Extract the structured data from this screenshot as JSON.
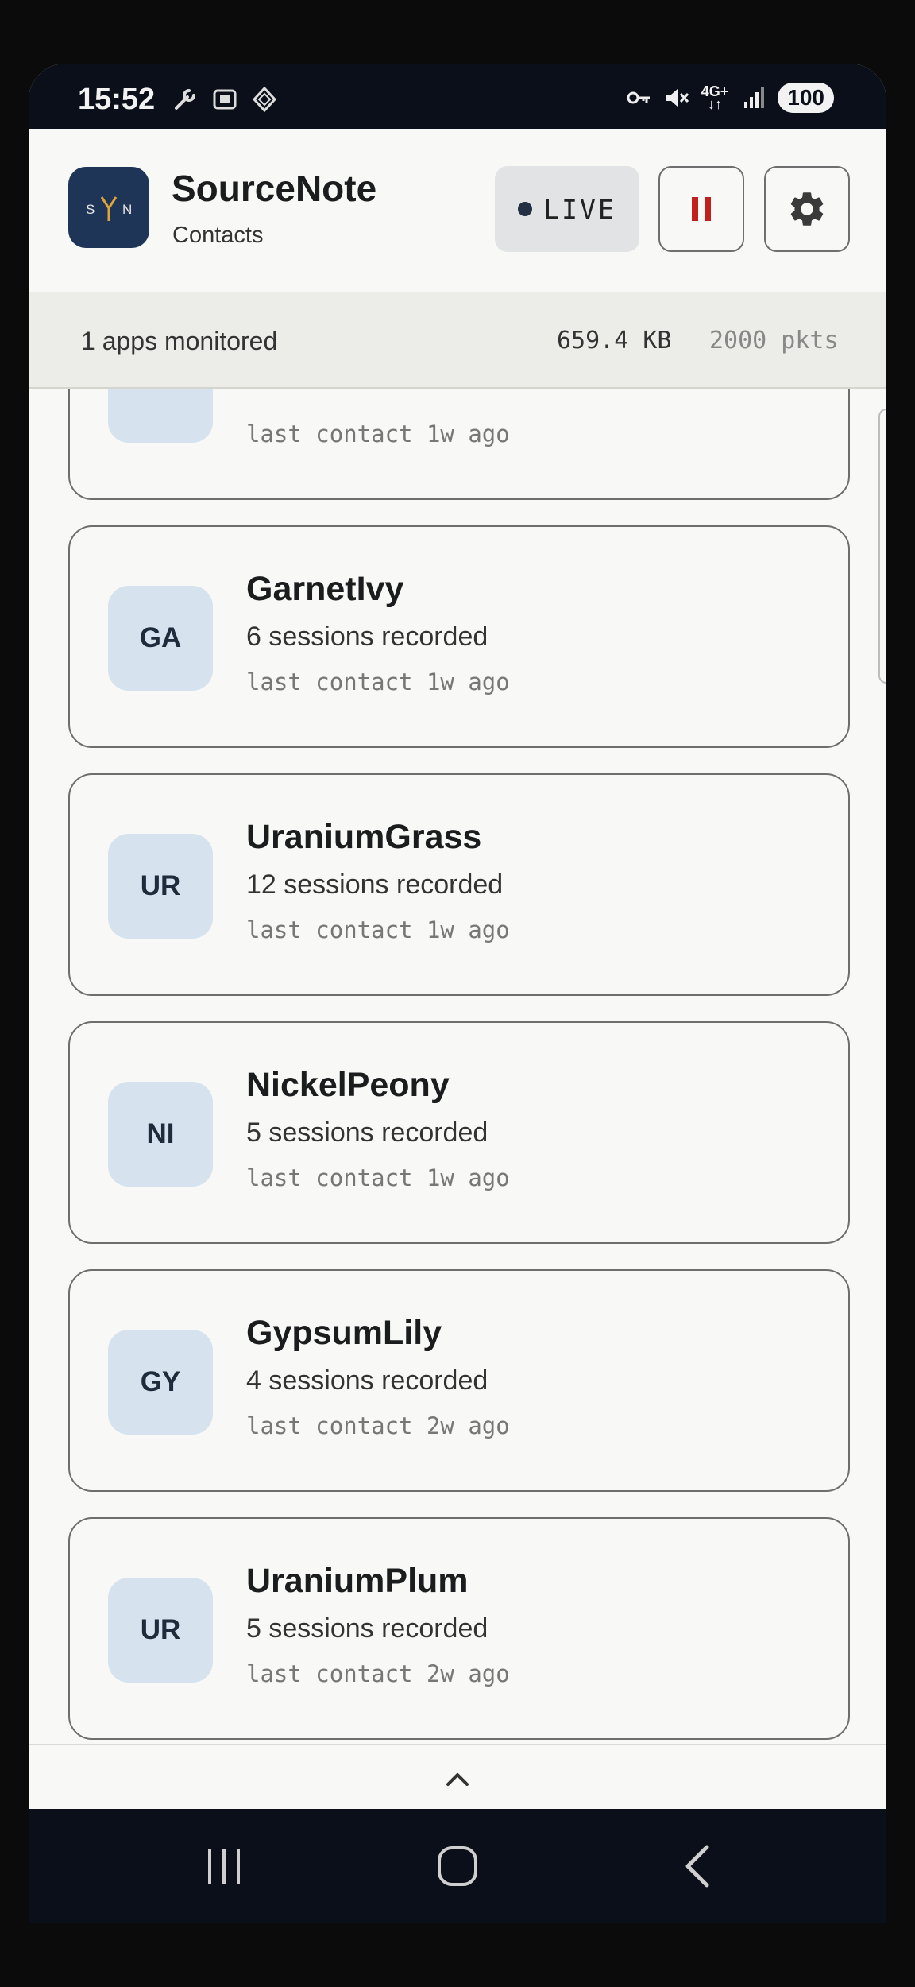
{
  "status_bar": {
    "time": "15:52",
    "battery": "100",
    "network": "4G+",
    "left_icons": [
      "wrench-icon",
      "screenshot-icon",
      "shield-icon"
    ],
    "right_icons": [
      "vpn-key-icon",
      "mute-icon",
      "network-icon",
      "signal-icon",
      "battery-icon"
    ]
  },
  "header": {
    "logo_text": "SYN",
    "title": "SourceNote",
    "subtitle": "Contacts",
    "live_label": "LIVE",
    "pause_icon": "pause-icon",
    "settings_icon": "gear-icon",
    "accent_color": "#1e3557",
    "pause_color": "#c0211f"
  },
  "info_bar": {
    "apps_monitored": "1 apps monitored",
    "data_size": "659.4 KB",
    "packets": "2000 pkts"
  },
  "contacts": [
    {
      "initials": "",
      "name": "",
      "sessions": "",
      "last_contact": "last contact 1w ago"
    },
    {
      "initials": "GA",
      "name": "GarnetIvy",
      "sessions": "6 sessions recorded",
      "last_contact": "last contact 1w ago"
    },
    {
      "initials": "UR",
      "name": "UraniumGrass",
      "sessions": "12 sessions recorded",
      "last_contact": "last contact 1w ago"
    },
    {
      "initials": "NI",
      "name": "NickelPeony",
      "sessions": "5 sessions recorded",
      "last_contact": "last contact 1w ago"
    },
    {
      "initials": "GY",
      "name": "GypsumLily",
      "sessions": "4 sessions recorded",
      "last_contact": "last contact 2w ago"
    },
    {
      "initials": "UR",
      "name": "UraniumPlum",
      "sessions": "5 sessions recorded",
      "last_contact": "last contact 2w ago"
    }
  ],
  "bottom_bar": {
    "icon": "chevron-up-icon"
  },
  "nav_bar": {
    "buttons": [
      "recents-icon",
      "home-icon",
      "back-icon"
    ]
  }
}
